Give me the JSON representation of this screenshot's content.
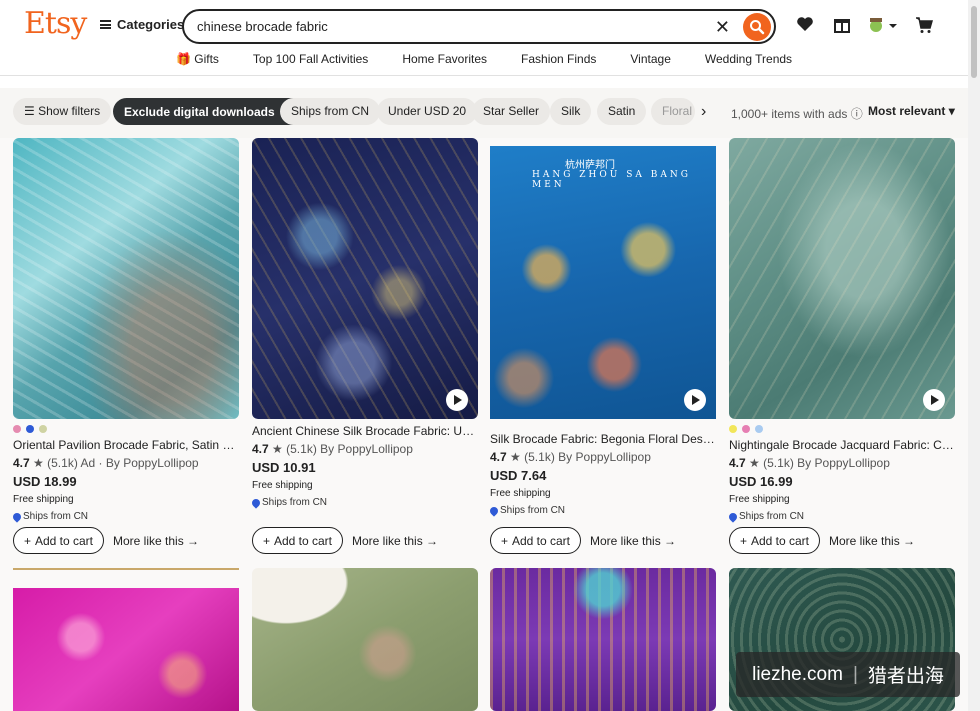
{
  "header": {
    "logo": "Etsy",
    "categories": "Categories",
    "search_value": "chinese brocade fabric"
  },
  "nav": [
    "Gifts",
    "Top 100 Fall Activities",
    "Home Favorites",
    "Fashion Finds",
    "Vintage",
    "Wedding Trends"
  ],
  "filters": {
    "show_filters": "Show filters",
    "exclude_digital": "Exclude digital downloads",
    "chips": [
      "Ships from CN",
      "Under USD 20",
      "Star Seller",
      "Silk",
      "Satin",
      "Floral"
    ],
    "items_count": "1,000+ items with ads",
    "sort": "Most relevant"
  },
  "products": [
    {
      "title": "Oriental Pavilion Brocade Fabric, Satin Jacquard...",
      "rating": "4.7",
      "reviews": "(5.1k)",
      "ad": "Ad",
      "seller": "By PoppyLollipop",
      "price": "USD 18.99",
      "shipping": "Free shipping",
      "ships_from": "Ships from CN",
      "swatches": [
        "#e58bb0",
        "#2e5ad6",
        "#cfd3a3"
      ]
    },
    {
      "title": "Ancient Chinese Silk Brocade Fabric: Upholstery...",
      "rating": "4.7",
      "reviews": "(5.1k)",
      "seller": "By PoppyLollipop",
      "price": "USD 10.91",
      "shipping": "Free shipping",
      "ships_from": "Ships from CN"
    },
    {
      "title": "Silk Brocade Fabric: Begonia Floral Design, Chin...",
      "rating": "4.7",
      "reviews": "(5.1k)",
      "seller": "By PoppyLollipop",
      "price": "USD 7.64",
      "shipping": "Free shipping",
      "ships_from": "Ships from CN",
      "image_caption": "HANG ZHOU SA BANG MEN",
      "image_caption_cn": "杭州萨邦门"
    },
    {
      "title": "Nightingale Brocade Jacquard Fabric: Chinese ...",
      "rating": "4.7",
      "reviews": "(5.1k)",
      "seller": "By PoppyLollipop",
      "price": "USD 16.99",
      "shipping": "Free shipping",
      "ships_from": "Ships from CN",
      "swatches": [
        "#f2e65a",
        "#e67fb3",
        "#a9cbf0"
      ]
    }
  ],
  "card_actions": {
    "add_to_cart": "Add to cart",
    "more_like_this": "More like this →"
  },
  "watermark": {
    "site": "liezhe.com",
    "cn": "猎者出海"
  },
  "colors": {
    "brand": "#f1641e",
    "chip_dark": "#2f3234"
  }
}
